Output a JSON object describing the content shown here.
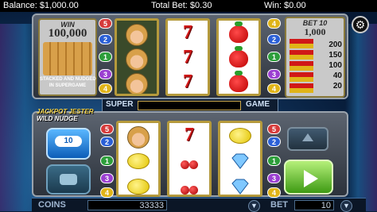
{
  "topbar": {
    "balance": "Balance: $1,000.00",
    "total_bet": "Total Bet: $0.30",
    "win": "Win: $0.00"
  },
  "upper_panel": {
    "win_label": "WIN",
    "win_amount": "100,000",
    "stacked_text_line1": "STACKED AND NUDGED",
    "stacked_text_line2": "IN SUPERGAME"
  },
  "paytable": {
    "bet_label": "BET 10",
    "top_amount": "1,000",
    "rows": [
      "200",
      "150",
      "100",
      "40",
      "20"
    ]
  },
  "super_bar": {
    "left": "SUPER",
    "right": "GAME"
  },
  "logo": {
    "line1": "JACKPOT JESTER",
    "line2": "WILD NUDGE"
  },
  "line_numbers_left_top": [
    "5",
    "2",
    "1",
    "3",
    "4"
  ],
  "line_numbers_right_top": [
    "4",
    "2",
    "1",
    "3",
    "4"
  ],
  "line_numbers_left_bottom": [
    "5",
    "2",
    "1",
    "3",
    "4"
  ],
  "line_numbers_right_bottom": [
    "5",
    "2",
    "1",
    "3",
    "4"
  ],
  "bet_button": {
    "value": "10"
  },
  "bottombar": {
    "coins_label": "COINS",
    "coins_value": "33333",
    "bet_label": "BET",
    "bet_value": "10"
  },
  "colors": {
    "line_red": "#d63a3a",
    "line_blue": "#2a5fd6",
    "line_green": "#2d9e3a",
    "line_yellow": "#e0b418",
    "line_purple": "#9b3fd1"
  },
  "icons": {
    "settings": "wrench-icon",
    "spin": "play-triangle-icon"
  }
}
